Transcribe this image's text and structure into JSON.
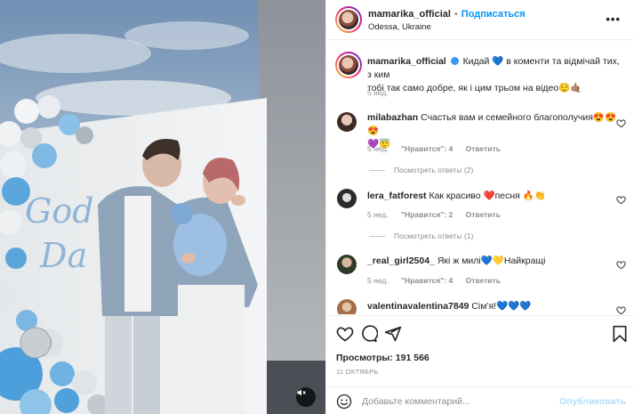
{
  "post": {
    "username": "mamarika_official",
    "separator": "•",
    "follow_label": "Подписаться",
    "location": "Odessa, Ukraine",
    "more_label": "•••"
  },
  "media": {
    "backdrop_text_1": "God",
    "backdrop_text_2": "Da"
  },
  "caption": {
    "username": "mamarika_official",
    "text_1": "Кидай 💙 в коменти та відмічай тих, з ким",
    "text_2": "тобі так само добре, як і цим трьом на відео😌🤙🏽",
    "age": "5 нед."
  },
  "comments": [
    {
      "username": "milabazhan",
      "text": "Счастья вам и семейного благополучия😍😍😍",
      "text_2": "💜😇",
      "age": "5 нед.",
      "likes": "\"Нравится\": 4",
      "reply": "Ответить",
      "replies": "Посмотреть ответы (2)"
    },
    {
      "username": "lera_fatforest",
      "text": "Как красиво ❤️песня 🔥👏",
      "age": "5 нед.",
      "likes": "\"Нравится\": 2",
      "reply": "Ответить",
      "replies": "Посмотреть ответы (1)"
    },
    {
      "username": "_real_girl2504_",
      "text": "Які ж милі💙💛Найкращі",
      "age": "5 нед.",
      "likes": "\"Нравится\": 4",
      "reply": "Ответить"
    },
    {
      "username": "valentinavalentina7849",
      "text": "Сім'я!💙💙💙"
    }
  ],
  "stats": {
    "views_label": "Просмотры: 191 566",
    "date": "11 ОКТЯБРЬ"
  },
  "add_comment": {
    "placeholder": "Добавьте комментарий...",
    "publish_label": "Опубликовать"
  }
}
